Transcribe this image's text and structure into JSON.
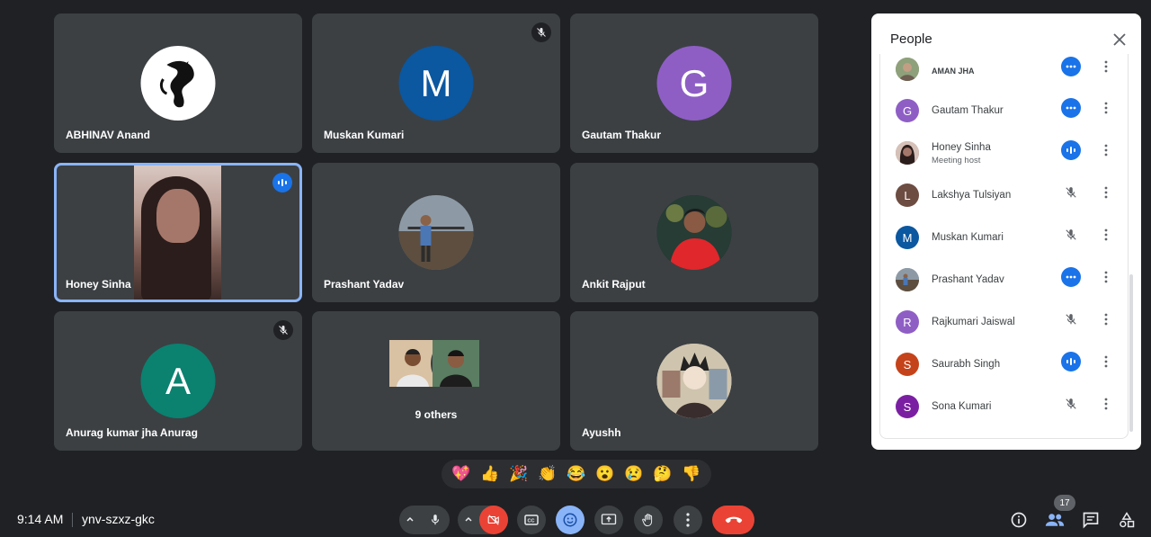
{
  "tiles": [
    {
      "name": "ABHINAV Anand"
    },
    {
      "name": "Muskan Kumari",
      "initial": "M",
      "color": "#0b57a0"
    },
    {
      "name": "Gautam Thakur",
      "initial": "G",
      "color": "#8e5ec5"
    },
    {
      "name": "Honey Sinha"
    },
    {
      "name": "Prashant Yadav"
    },
    {
      "name": "Ankit Rajput"
    },
    {
      "name": "Anurag kumar jha Anurag",
      "initial": "A",
      "color": "#0b8170"
    },
    {
      "others": "9 others"
    },
    {
      "name": "Ayushh"
    }
  ],
  "reactions": [
    "💖",
    "👍",
    "🎉",
    "👏",
    "😂",
    "😮",
    "😢",
    "🤔",
    "👎"
  ],
  "bottom": {
    "time": "9:14 AM",
    "meeting_code": "ynv-szxz-gkc",
    "participant_count": "17",
    "leave_color": "#ea4335",
    "accent": "#8ab4f8"
  },
  "people_panel": {
    "title": "People",
    "participants": [
      {
        "name": "AMAN JHA",
        "status": "more"
      },
      {
        "name": "Gautam Thakur",
        "initial": "G",
        "color": "#8e5ec5",
        "status": "more"
      },
      {
        "name": "Honey Sinha",
        "sub": "Meeting host",
        "status": "speaking"
      },
      {
        "name": "Lakshya Tulsiyan",
        "initial": "L",
        "color": "#6d4c41",
        "status": "muted"
      },
      {
        "name": "Muskan Kumari",
        "initial": "M",
        "color": "#0b57a0",
        "status": "muted"
      },
      {
        "name": "Prashant Yadav",
        "status": "more"
      },
      {
        "name": "Rajkumari Jaiswal",
        "initial": "R",
        "color": "#8e5ec5",
        "status": "muted"
      },
      {
        "name": "Saurabh Singh",
        "initial": "S",
        "color": "#c5431a",
        "status": "speaking"
      },
      {
        "name": "Sona Kumari",
        "initial": "S",
        "color": "#7b1fa2",
        "status": "muted"
      }
    ]
  }
}
